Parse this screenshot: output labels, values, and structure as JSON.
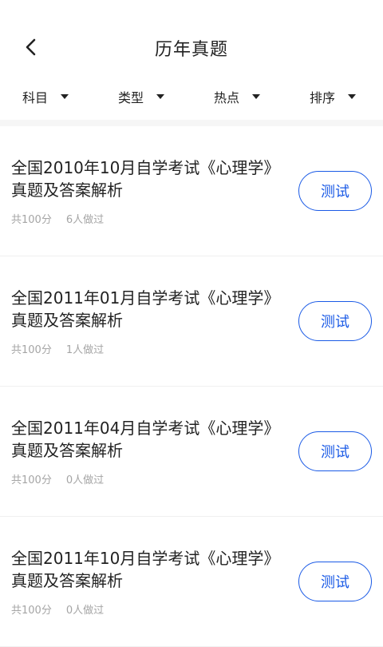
{
  "header": {
    "title": "历年真题",
    "back_icon": "chevron-left-icon"
  },
  "filters": [
    {
      "label": "科目"
    },
    {
      "label": "类型"
    },
    {
      "label": "热点"
    },
    {
      "label": "排序"
    }
  ],
  "items": [
    {
      "title": "全国2010年10月自学考试《心理学》真题及答案解析",
      "score": "共100分",
      "count": "6人做过",
      "button": "测试"
    },
    {
      "title": "全国2011年01月自学考试《心理学》真题及答案解析",
      "score": "共100分",
      "count": "1人做过",
      "button": "测试"
    },
    {
      "title": "全国2011年04月自学考试《心理学》真题及答案解析",
      "score": "共100分",
      "count": "0人做过",
      "button": "测试"
    },
    {
      "title": "全国2011年10月自学考试《心理学》真题及答案解析",
      "score": "共100分",
      "count": "0人做过",
      "button": "测试"
    }
  ],
  "colors": {
    "accent": "#1a5ae6",
    "meta_text": "#a5a5a5",
    "text": "#222222"
  }
}
